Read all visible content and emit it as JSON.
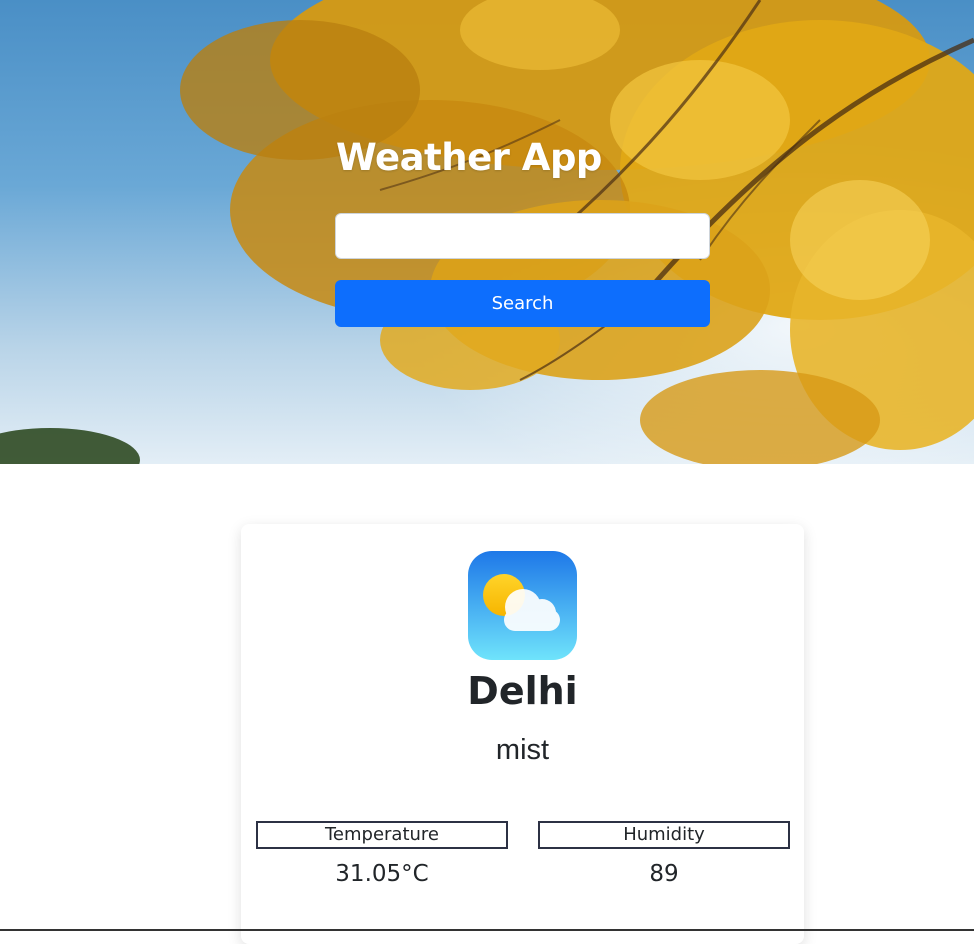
{
  "header": {
    "title": "Weather App",
    "search_value": "",
    "search_placeholder": "",
    "search_button_label": "Search",
    "background": "autumn-maple-leaves-sky-photo"
  },
  "weather": {
    "icon": "partly-cloudy-icon",
    "city": "Delhi",
    "condition": "mist",
    "stats": {
      "temperature_label": "Temperature",
      "temperature_value": "31.05°C",
      "humidity_label": "Humidity",
      "humidity_value": "89"
    }
  },
  "colors": {
    "primary_button": "#0d6efd",
    "text": "#212529",
    "stat_border": "#2c3144"
  }
}
